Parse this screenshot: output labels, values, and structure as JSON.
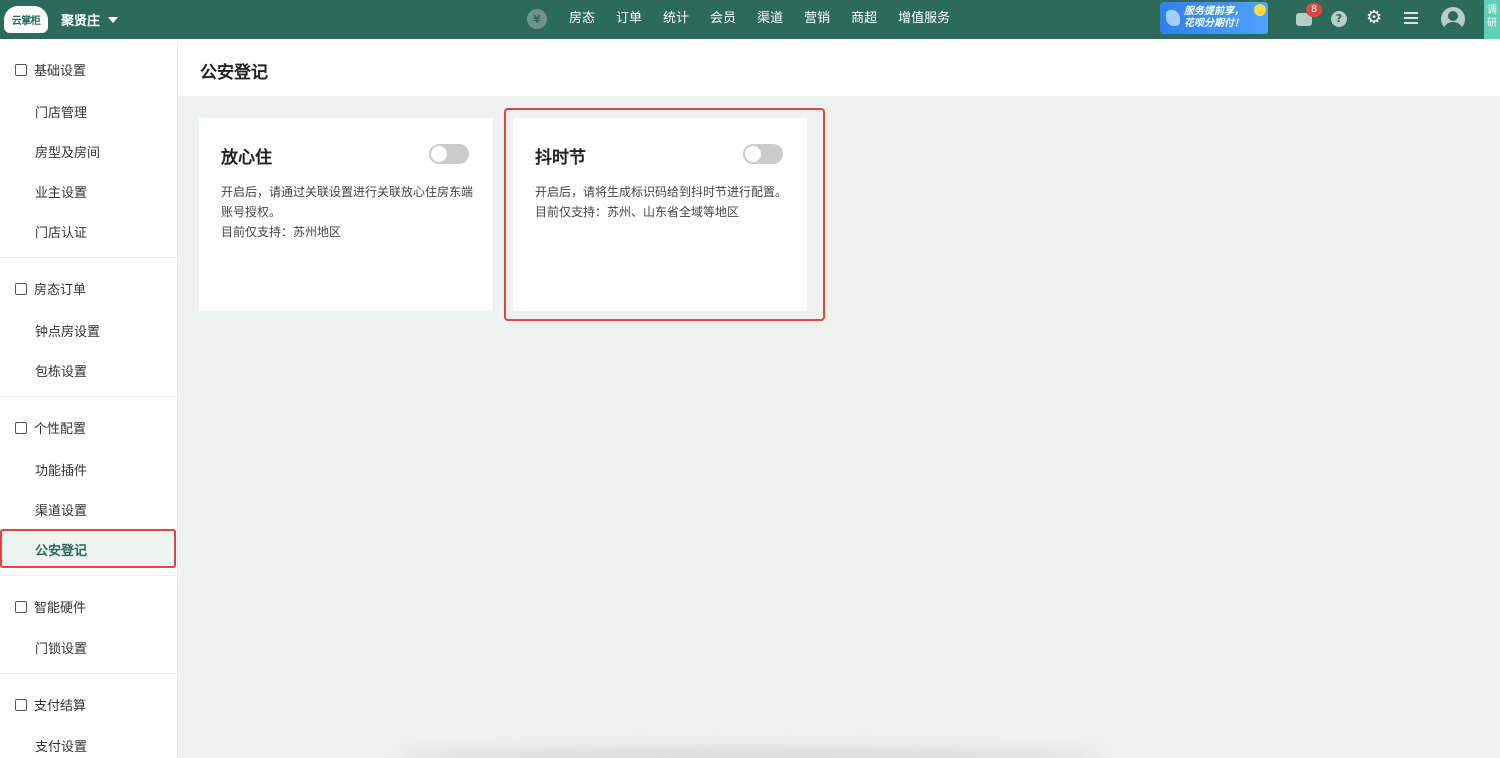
{
  "topbar": {
    "logo_text": "云掌柜",
    "store_name": "聚贤庄",
    "currency_symbol": "¥",
    "nav": [
      "房态",
      "订单",
      "统计",
      "会员",
      "渠道",
      "营销",
      "商超",
      "增值服务"
    ],
    "banner_line1": "服务提前享，",
    "banner_line2": "花呗分期付！",
    "message_count": "8",
    "help_glyph": "?",
    "gear_glyph": "⚙",
    "survey_text": "调研"
  },
  "sidebar": {
    "groups": [
      {
        "title": "基础设置",
        "icon": "home-icon",
        "items": [
          "门店管理",
          "房型及房间",
          "业主设置",
          "门店认证"
        ]
      },
      {
        "title": "房态订单",
        "icon": "calendar-icon",
        "items": [
          "钟点房设置",
          "包栋设置"
        ]
      },
      {
        "title": "个性配置",
        "icon": "config-icon",
        "items": [
          "功能插件",
          "渠道设置",
          "公安登记"
        ]
      },
      {
        "title": "智能硬件",
        "icon": "device-icon",
        "items": [
          "门锁设置"
        ]
      },
      {
        "title": "支付结算",
        "icon": "payment-icon",
        "items": [
          "支付设置"
        ]
      }
    ],
    "active_item": "公安登记"
  },
  "main": {
    "title": "公安登记",
    "cards": [
      {
        "title": "放心住",
        "enabled": false,
        "desc_line1": "开启后，请通过关联设置进行关联放心住房东端账号授权。",
        "desc_line2": "目前仅支持：苏州地区"
      },
      {
        "title": "抖时节",
        "enabled": false,
        "desc_line1": "开启后，请将生成标识码给到抖时节进行配置。",
        "desc_line2": "目前仅支持：苏州、山东省全域等地区"
      }
    ]
  },
  "colors": {
    "brand": "#2c6b5a",
    "highlight": "#e0453a",
    "background": "#eef1f0"
  }
}
